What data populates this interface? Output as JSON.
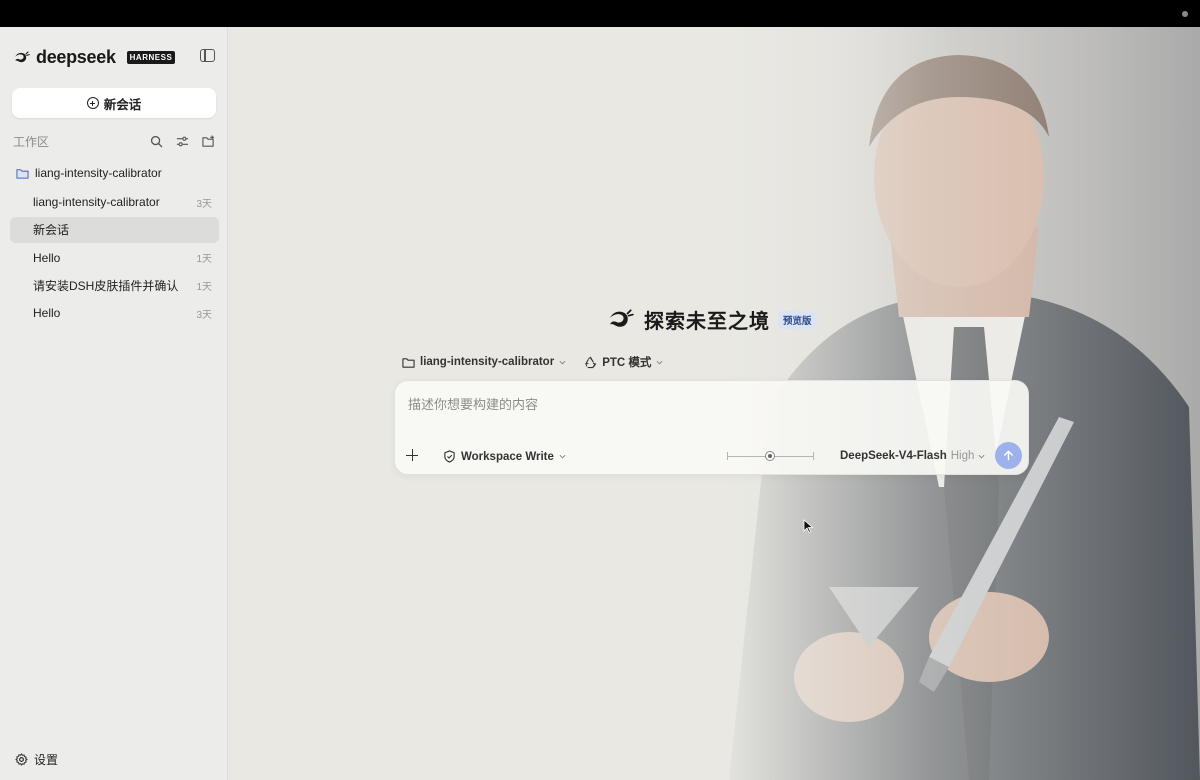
{
  "window": {
    "title_bar": ""
  },
  "sidebar": {
    "brand": {
      "logo_text": "deepseek",
      "tag": "HARNESS"
    },
    "new_chat_label": "新会话",
    "workspace_label": "工作区",
    "folder_name": "liang-intensity-calibrator",
    "sessions": [
      {
        "name": "liang-intensity-calibrator",
        "age": "3天",
        "active": false
      },
      {
        "name": "新会话",
        "age": "",
        "active": true
      },
      {
        "name": "Hello",
        "age": "1天",
        "active": false
      },
      {
        "name": "请安装DSH皮肤插件并确认",
        "age": "1天",
        "active": false
      },
      {
        "name": "Hello",
        "age": "3天",
        "active": false
      }
    ],
    "settings_label": "设置"
  },
  "main": {
    "hero_title": "探索未至之境",
    "hero_badge": "预览版",
    "context": {
      "project": "liang-intensity-calibrator",
      "mode": "PTC 模式"
    },
    "composer": {
      "placeholder": "描述你想要构建的内容",
      "permission": "Workspace Write",
      "model": "DeepSeek-V4-Flash",
      "effort": "High"
    }
  },
  "colors": {
    "send_button": "#9db2ea",
    "badge_bg": "#dce4f3",
    "badge_text": "#2d4e8c",
    "active_session": "#dcdcda"
  },
  "icons": [
    "deepseek-whale-icon",
    "sidebar-toggle-icon",
    "plus-circle-icon",
    "search-icon",
    "filter-icon",
    "new-folder-icon",
    "folder-icon",
    "gear-icon",
    "recycle-icon",
    "shield-icon",
    "chevron-down-icon",
    "plus-icon",
    "arrow-up-icon",
    "mouse-cursor-icon"
  ]
}
